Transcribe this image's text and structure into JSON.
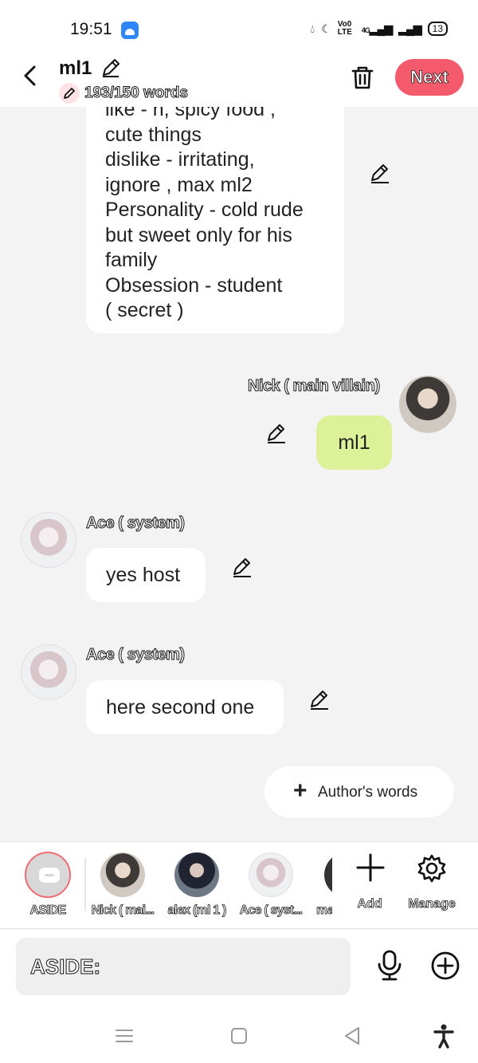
{
  "status_bar": {
    "time": "19:51",
    "net_label": "Vo0 LTE",
    "network_label": "4G",
    "battery": "13",
    "notification_icon": "chat-app-icon"
  },
  "header": {
    "title": "ml1",
    "word_count": "193/150 words",
    "next_label": "Next"
  },
  "messages": {
    "bio_lines": [
      "like - h, spicy food ,",
      "cute things",
      "dislike - irritating,",
      "ignore , max ml2",
      "Personality - cold rude",
      "but sweet only for his",
      "family",
      "Obsession - student",
      "( secret )"
    ],
    "nick_name": "Nick ( main villain)",
    "nick_text": "ml1",
    "ace_name": "Ace ( system)",
    "ace_text_1": "yes host",
    "ace_text_2": "here second one"
  },
  "author_words": {
    "label": "Author's words"
  },
  "characters": [
    {
      "label": "ASIDE"
    },
    {
      "label": "Nick ( mai..."
    },
    {
      "label": "alex (ml 1 )"
    },
    {
      "label": "Ace ( syst..."
    },
    {
      "label": "ma"
    }
  ],
  "tools": {
    "add_label": "Add",
    "manage_label": "Manage"
  },
  "composer": {
    "text": "ASIDE:"
  },
  "colors": {
    "accent": "#f45a6b",
    "green_bubble": "#ddf199",
    "background": "#f3f3f3"
  }
}
